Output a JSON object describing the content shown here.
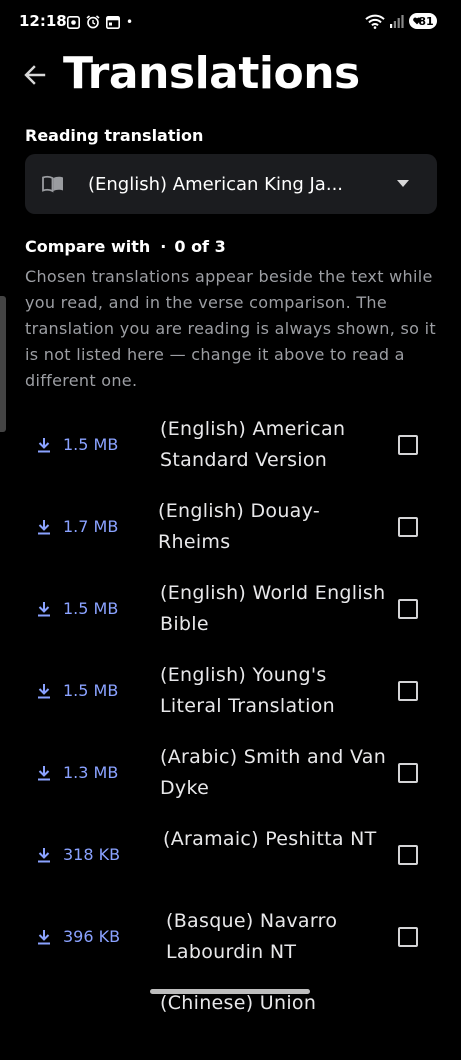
{
  "status_bar": {
    "time": "12:18",
    "battery": "81",
    "dot": "•"
  },
  "header": {
    "title": "Translations"
  },
  "reading": {
    "label": "Reading translation",
    "selected": "(English) American King Ja..."
  },
  "compare": {
    "label": "Compare with",
    "separator": "·",
    "count": "0 of 3",
    "description": "Chosen translations appear beside the text while you read, and in the verse comparison. The translation you are reading is always shown, so it is not listed here — change it above to read a different one."
  },
  "translations": [
    {
      "size": "1.5 MB",
      "name": "(English) American Standard Version",
      "checked": false
    },
    {
      "size": "1.7 MB",
      "name": "(English) Douay-Rheims",
      "checked": false
    },
    {
      "size": "1.5 MB",
      "name": "(English) World English Bible",
      "checked": false
    },
    {
      "size": "1.5 MB",
      "name": "(English) Young's Literal Translation",
      "checked": false
    },
    {
      "size": "1.3 MB",
      "name": "(Arabic) Smith and Van Dyke",
      "checked": false
    },
    {
      "size": "318 KB",
      "name": "(Aramaic) Peshitta NT",
      "checked": false
    },
    {
      "size": "396 KB",
      "name": "(Basque) Navarro Labourdin NT",
      "checked": false
    },
    {
      "size": "",
      "name": "(Chinese) Union",
      "checked": false
    }
  ],
  "colors": {
    "background": "#000000",
    "accent": "#8aa2ff",
    "muted_text": "#9c9ea3",
    "dropdown_bg": "#1b1c1f"
  }
}
